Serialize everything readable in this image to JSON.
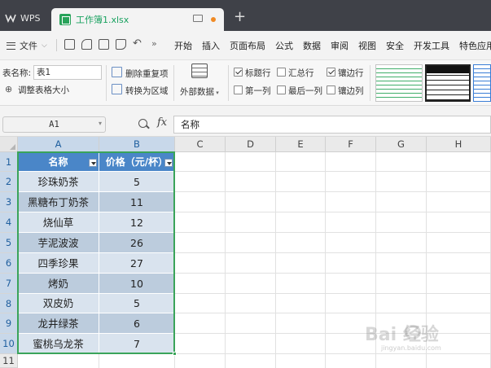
{
  "titlebar": {
    "app_tab": "WPS",
    "file_tab": "工作簿1.xlsx",
    "add_tab": "+"
  },
  "menubar": {
    "file_menu": "文件",
    "more": "»",
    "items": [
      "开始",
      "插入",
      "页面布局",
      "公式",
      "数据",
      "审阅",
      "视图",
      "安全",
      "开发工具",
      "特色应用"
    ]
  },
  "ribbon": {
    "table_name_label": "表名称:",
    "table_name_value": "表1",
    "resize_table": "调整表格大小",
    "remove_duplicates": "删除重复项",
    "convert_to_range": "转换为区域",
    "external_data": "外部数据",
    "options": {
      "header_row": {
        "label": "标题行",
        "checked": true
      },
      "total_row": {
        "label": "汇总行",
        "checked": false
      },
      "banded_rows": {
        "label": "镶边行",
        "checked": true
      },
      "first_column": {
        "label": "第一列",
        "checked": false
      },
      "last_column": {
        "label": "最后一列",
        "checked": false
      },
      "banded_columns": {
        "label": "镶边列",
        "checked": false
      }
    }
  },
  "formula_bar": {
    "name_box": "A1",
    "fx": "fx",
    "value": "名称"
  },
  "sheet": {
    "columns": [
      "A",
      "B",
      "C",
      "D",
      "E",
      "F",
      "G",
      "H"
    ],
    "rows": [
      "1",
      "2",
      "3",
      "4",
      "5",
      "6",
      "7",
      "8",
      "9",
      "10",
      "11"
    ],
    "header": [
      "名称",
      "价格（元/杯）"
    ],
    "data": [
      [
        "珍珠奶茶",
        "5"
      ],
      [
        "黑糖布丁奶茶",
        "11"
      ],
      [
        "烧仙草",
        "12"
      ],
      [
        "芋泥波波",
        "26"
      ],
      [
        "四季珍果",
        "27"
      ],
      [
        "烤奶",
        "10"
      ],
      [
        "双皮奶",
        "5"
      ],
      [
        "龙井绿茶",
        "6"
      ],
      [
        "蜜桃乌龙茶",
        "7"
      ]
    ],
    "selection_color": "#3aa45a",
    "header_fill": "#4a86c8",
    "band_fill_light": "#d9e3ee",
    "band_fill_dark": "#bcccdd"
  },
  "watermark": {
    "text": "Bai 经验",
    "sub": "jingyan.baidu.com"
  }
}
